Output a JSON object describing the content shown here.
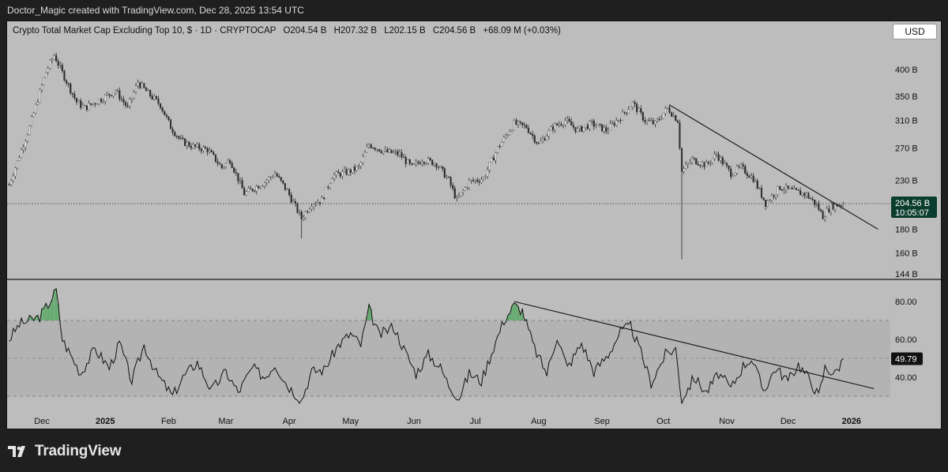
{
  "header": {
    "attribution": "Doctor_Magic created with TradingView.com, Dec 28, 2025 13:54 UTC",
    "legend_line": "Crypto Total Market Cap Excluding Top 10, $ · 1D · CRYPTOCAP",
    "ohlc": [
      {
        "label": "O",
        "value": "204.54 B"
      },
      {
        "label": "H",
        "value": "207.32 B"
      },
      {
        "label": "L",
        "value": "202.15 B"
      },
      {
        "label": "C",
        "value": "204.56 B"
      }
    ],
    "change": "+68.09 M (+0.03%)",
    "currency_button": "USD"
  },
  "colors": {
    "background": "#bdbdbd",
    "up_candle": "#f2f2f2",
    "down_candle": "#2b2b2b",
    "price_tag_bg": "#0b3d2e",
    "rsi_overbought_fill": "#3fa34d"
  },
  "chart_data": [
    {
      "type": "candlestick",
      "title": "Crypto Total Market Cap Excluding Top 10, $ · 1D · CRYPTOCAP",
      "x_axis": {
        "tick_labels": [
          "Dec",
          "2025",
          "Feb",
          "Mar",
          "Apr",
          "May",
          "Jun",
          "Jul",
          "Aug",
          "Sep",
          "Oct",
          "Nov",
          "Dec",
          "2026"
        ]
      },
      "y_axis": {
        "scale": "log",
        "unit": "B",
        "tick_labels": [
          "400 B",
          "350 B",
          "310 B",
          "270 B",
          "230 B",
          "180 B",
          "160 B",
          "144 B"
        ],
        "range": [
          140,
          460
        ]
      },
      "series": [
        {
          "approx_close_path": [
            [
              "2024-11-15",
              225
            ],
            [
              "2024-11-25",
              300
            ],
            [
              "2024-12-03",
              395
            ],
            [
              "2024-12-07",
              430
            ],
            [
              "2024-12-12",
              385
            ],
            [
              "2024-12-18",
              340
            ],
            [
              "2024-12-22",
              330
            ],
            [
              "2024-12-30",
              345
            ],
            [
              "2025-01-06",
              360
            ],
            [
              "2025-01-12",
              330
            ],
            [
              "2025-01-17",
              375
            ],
            [
              "2025-01-22",
              355
            ],
            [
              "2025-01-28",
              335
            ],
            [
              "2025-02-02",
              300
            ],
            [
              "2025-02-07",
              280
            ],
            [
              "2025-02-13",
              272
            ],
            [
              "2025-02-20",
              268
            ],
            [
              "2025-02-27",
              245
            ],
            [
              "2025-03-03",
              255
            ],
            [
              "2025-03-10",
              215
            ],
            [
              "2025-03-20",
              228
            ],
            [
              "2025-03-25",
              238
            ],
            [
              "2025-03-31",
              218
            ],
            [
              "2025-04-07",
              190
            ],
            [
              "2025-04-12",
              205
            ],
            [
              "2025-04-17",
              208
            ],
            [
              "2025-04-22",
              235
            ],
            [
              "2025-04-30",
              240
            ],
            [
              "2025-05-05",
              245
            ],
            [
              "2025-05-10",
              275
            ],
            [
              "2025-05-18",
              265
            ],
            [
              "2025-05-25",
              262
            ],
            [
              "2025-05-31",
              245
            ],
            [
              "2025-06-05",
              255
            ],
            [
              "2025-06-12",
              250
            ],
            [
              "2025-06-18",
              230
            ],
            [
              "2025-06-22",
              208
            ],
            [
              "2025-06-28",
              228
            ],
            [
              "2025-07-05",
              232
            ],
            [
              "2025-07-12",
              270
            ],
            [
              "2025-07-20",
              305
            ],
            [
              "2025-07-26",
              300
            ],
            [
              "2025-08-01",
              275
            ],
            [
              "2025-08-08",
              300
            ],
            [
              "2025-08-14",
              310
            ],
            [
              "2025-08-20",
              295
            ],
            [
              "2025-08-27",
              305
            ],
            [
              "2025-09-03",
              295
            ],
            [
              "2025-09-10",
              315
            ],
            [
              "2025-09-16",
              338
            ],
            [
              "2025-09-22",
              310
            ],
            [
              "2025-09-27",
              305
            ],
            [
              "2025-10-03",
              330
            ],
            [
              "2025-10-08",
              310
            ],
            [
              "2025-10-10",
              240
            ],
            [
              "2025-10-15",
              255
            ],
            [
              "2025-10-22",
              248
            ],
            [
              "2025-10-27",
              262
            ],
            [
              "2025-11-03",
              238
            ],
            [
              "2025-11-08",
              245
            ],
            [
              "2025-11-14",
              232
            ],
            [
              "2025-11-20",
              205
            ],
            [
              "2025-11-27",
              222
            ],
            [
              "2025-12-03",
              218
            ],
            [
              "2025-12-10",
              214
            ],
            [
              "2025-12-15",
              203
            ],
            [
              "2025-12-18",
              192
            ],
            [
              "2025-12-22",
              202
            ],
            [
              "2025-12-28",
              204.56
            ]
          ],
          "wick_extremes": [
            {
              "date": "2025-04-07",
              "low": 172
            },
            {
              "date": "2025-10-10",
              "low": 155
            }
          ]
        }
      ],
      "current_price_tag": {
        "value": "204.56 B",
        "countdown": "10:05:07"
      },
      "trendline": {
        "from": [
          "2025-10-04",
          335
        ],
        "to": [
          "2026-01-14",
          180
        ]
      }
    },
    {
      "type": "line",
      "title": "",
      "y_axis": {
        "tick_labels": [
          "80.00",
          "60.00",
          "40.00"
        ],
        "range": [
          25,
          90
        ]
      },
      "band": {
        "upper": 70,
        "middle": 50,
        "lower": 30
      },
      "current_value_tag": "49.79",
      "series": [
        {
          "points": [
            [
              "2024-11-15",
              60
            ],
            [
              "2024-11-20",
              68
            ],
            [
              "2024-11-25",
              70
            ],
            [
              "2024-11-30",
              72
            ],
            [
              "2024-12-05",
              80
            ],
            [
              "2024-12-08",
              86
            ],
            [
              "2024-12-11",
              60
            ],
            [
              "2024-12-15",
              52
            ],
            [
              "2024-12-20",
              42
            ],
            [
              "2024-12-27",
              55
            ],
            [
              "2025-01-03",
              45
            ],
            [
              "2025-01-08",
              58
            ],
            [
              "2025-01-14",
              38
            ],
            [
              "2025-01-20",
              57
            ],
            [
              "2025-01-26",
              42
            ],
            [
              "2025-02-03",
              30
            ],
            [
              "2025-02-08",
              40
            ],
            [
              "2025-02-15",
              48
            ],
            [
              "2025-02-22",
              33
            ],
            [
              "2025-03-01",
              43
            ],
            [
              "2025-03-07",
              32
            ],
            [
              "2025-03-14",
              45
            ],
            [
              "2025-03-20",
              40
            ],
            [
              "2025-03-25",
              47
            ],
            [
              "2025-03-31",
              36
            ],
            [
              "2025-04-07",
              28
            ],
            [
              "2025-04-12",
              43
            ],
            [
              "2025-04-18",
              44
            ],
            [
              "2025-04-25",
              57
            ],
            [
              "2025-05-01",
              63
            ],
            [
              "2025-05-06",
              57
            ],
            [
              "2025-05-10",
              76
            ],
            [
              "2025-05-15",
              62
            ],
            [
              "2025-05-22",
              67
            ],
            [
              "2025-05-27",
              55
            ],
            [
              "2025-06-02",
              42
            ],
            [
              "2025-06-08",
              52
            ],
            [
              "2025-06-14",
              45
            ],
            [
              "2025-06-18",
              36
            ],
            [
              "2025-06-23",
              29
            ],
            [
              "2025-06-28",
              42
            ],
            [
              "2025-07-04",
              38
            ],
            [
              "2025-07-10",
              56
            ],
            [
              "2025-07-15",
              70
            ],
            [
              "2025-07-20",
              78
            ],
            [
              "2025-07-24",
              75
            ],
            [
              "2025-07-30",
              55
            ],
            [
              "2025-08-05",
              42
            ],
            [
              "2025-08-10",
              62
            ],
            [
              "2025-08-15",
              45
            ],
            [
              "2025-08-22",
              58
            ],
            [
              "2025-08-28",
              43
            ],
            [
              "2025-09-04",
              52
            ],
            [
              "2025-09-10",
              64
            ],
            [
              "2025-09-15",
              67
            ],
            [
              "2025-09-20",
              53
            ],
            [
              "2025-09-25",
              37
            ],
            [
              "2025-10-02",
              52
            ],
            [
              "2025-10-07",
              55
            ],
            [
              "2025-10-10",
              28
            ],
            [
              "2025-10-16",
              40
            ],
            [
              "2025-10-22",
              32
            ],
            [
              "2025-10-28",
              42
            ],
            [
              "2025-11-03",
              34
            ],
            [
              "2025-11-09",
              46
            ],
            [
              "2025-11-13",
              50
            ],
            [
              "2025-11-19",
              33
            ],
            [
              "2025-11-25",
              45
            ],
            [
              "2025-12-01",
              38
            ],
            [
              "2025-12-06",
              47
            ],
            [
              "2025-12-12",
              38
            ],
            [
              "2025-12-16",
              30
            ],
            [
              "2025-12-19",
              45
            ],
            [
              "2025-12-24",
              42
            ],
            [
              "2025-12-28",
              49.79
            ]
          ]
        }
      ],
      "trendline": {
        "from": [
          "2025-07-20",
          80
        ],
        "to": [
          "2026-01-12",
          34
        ]
      }
    }
  ]
}
